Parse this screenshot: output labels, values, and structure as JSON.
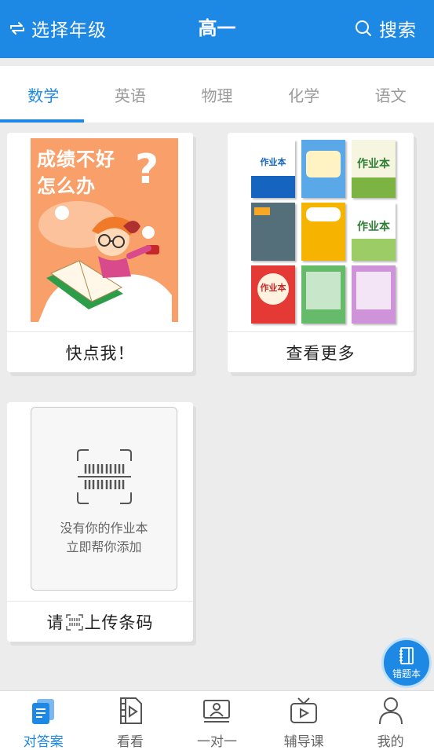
{
  "header": {
    "grade_selector_label": "选择年级",
    "title": "高一",
    "search_label": "搜索"
  },
  "subject_tabs": [
    {
      "label": "数学",
      "active": true
    },
    {
      "label": "英语",
      "active": false
    },
    {
      "label": "物理",
      "active": false
    },
    {
      "label": "化学",
      "active": false
    },
    {
      "label": "语文",
      "active": false
    }
  ],
  "cards": {
    "promo": {
      "image_text_line1": "成绩不好",
      "image_text_line2": "怎么办",
      "image_question_mark": "?",
      "label": "快点我！"
    },
    "more": {
      "label": "查看更多",
      "book_titles": [
        "作业本",
        "作业本",
        "作业本",
        "作业本"
      ]
    },
    "add": {
      "line1": "没有你的作业本",
      "line2": "立即帮你添加",
      "label_before": "请",
      "label_after": "上传条码"
    }
  },
  "fab": {
    "label": "错题本"
  },
  "bottom_nav": [
    {
      "label": "对答案",
      "icon": "document-copy-icon",
      "active": true
    },
    {
      "label": "看看",
      "icon": "video-file-icon",
      "active": false
    },
    {
      "label": "一对一",
      "icon": "teacher-board-icon",
      "active": false
    },
    {
      "label": "辅导课",
      "icon": "tv-icon",
      "active": false
    },
    {
      "label": "我的",
      "icon": "person-icon",
      "active": false
    }
  ],
  "colors": {
    "primary": "#1e88e5",
    "promo_bg": "#f9a06a",
    "page_bg": "#ececec"
  }
}
